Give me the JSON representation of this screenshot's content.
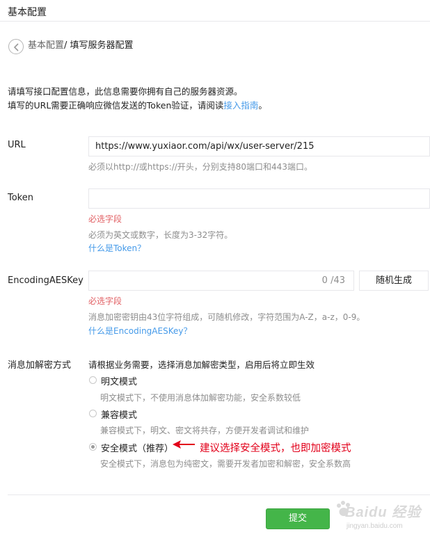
{
  "page": {
    "title": "基本配置"
  },
  "breadcrumb": {
    "parent": "基本配置",
    "separator": "/",
    "current": "填写服务器配置"
  },
  "intro": {
    "line1": "请填写接口配置信息，此信息需要你拥有自己的服务器资源。",
    "line2_prefix": "填写的URL需要正确响应微信发送的Token验证，请阅读",
    "line2_link": "接入指南",
    "line2_suffix": "。"
  },
  "url_field": {
    "label": "URL",
    "value": "https://www.yuxiaor.com/api/wx/user-server/215",
    "hint": "必须以http://或https://开头，分别支持80端口和443端口。"
  },
  "token_field": {
    "label": "Token",
    "value": "",
    "required_text": "必选字段",
    "hint": "必须为英文或数字，长度为3-32字符。",
    "help_link": "什么是Token？"
  },
  "aes_field": {
    "label": "EncodingAESKey",
    "value": "",
    "counter": "0 /43",
    "generate_button": "随机生成",
    "required_text": "必选字段",
    "hint": "消息加密密钥由43位字符组成，可随机修改，字符范围为A-Z，a-z，0-9。",
    "help_link": "什么是EncodingAESKey？"
  },
  "encryption": {
    "label": "消息加解密方式",
    "prompt": "请根据业务需要，选择消息加解密类型，启用后将立即生效",
    "options": [
      {
        "label": "明文模式",
        "desc": "明文模式下，不使用消息体加解密功能，安全系数较低",
        "checked": false
      },
      {
        "label": "兼容模式",
        "desc": "兼容模式下，明文、密文将共存，方便开发者调试和维护",
        "checked": false
      },
      {
        "label": "安全模式（推荐）",
        "desc": "安全模式下，消息包为纯密文，需要开发者加密和解密，安全系数高",
        "checked": true
      }
    ],
    "annotation": "建议选择安全模式，也即加密模式"
  },
  "footer": {
    "submit_label": "提交"
  },
  "watermark": {
    "brand": "Baidu 经验",
    "url": "jingyan.baidu.com"
  },
  "colors": {
    "accent_link": "#459ae9",
    "required_red": "#e15f63",
    "annotation_red": "#e2001a",
    "submit_green": "#44b549"
  }
}
